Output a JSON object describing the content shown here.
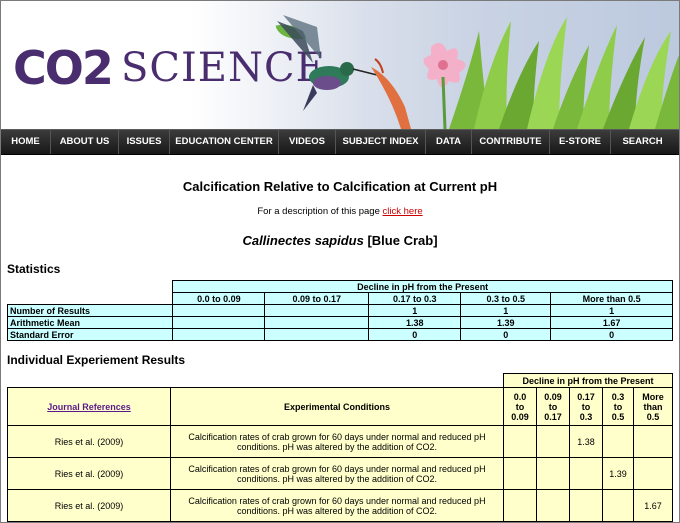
{
  "brand": {
    "co2": "CO2",
    "science": "SCIENCE"
  },
  "nav": [
    "HOME",
    "ABOUT US",
    "ISSUES",
    "EDUCATION CENTER",
    "VIDEOS",
    "SUBJECT INDEX",
    "DATA",
    "CONTRIBUTE",
    "E-STORE",
    "SEARCH"
  ],
  "page": {
    "title": "Calcification Relative to Calcification at Current pH",
    "description": "For a description of this page",
    "link": "click here",
    "species_italic": "Callinectes sapidus",
    "species_common": "[Blue Crab]"
  },
  "statistics": {
    "heading": "Statistics",
    "group_header": "Decline in pH from the Present",
    "columns": [
      "0.0 to 0.09",
      "0.09 to 0.17",
      "0.17 to 0.3",
      "0.3 to 0.5",
      "More than 0.5"
    ],
    "rows": [
      {
        "label": "Number of Results",
        "values": [
          "",
          "",
          "1",
          "1",
          "1"
        ]
      },
      {
        "label": "Arithmetic Mean",
        "values": [
          "",
          "",
          "1.38",
          "1.39",
          "1.67"
        ]
      },
      {
        "label": "Standard Error",
        "values": [
          "",
          "",
          "0",
          "0",
          "0"
        ]
      }
    ]
  },
  "experiments": {
    "heading": "Individual Experiement Results",
    "group_header": "Decline in pH from the Present",
    "col_journal": "Journal References",
    "col_conditions": "Experimental Conditions",
    "columns": [
      [
        "0.0",
        "to",
        "0.09"
      ],
      [
        "0.09",
        "to",
        "0.17"
      ],
      [
        "0.17",
        "to",
        "0.3"
      ],
      [
        "0.3",
        "to",
        "0.5"
      ],
      [
        "More",
        "than",
        "0.5"
      ]
    ],
    "rows": [
      {
        "ref": "Ries et al. (2009)",
        "cond": "Calcification rates of crab grown for 60 days under normal and reduced pH conditions. pH was altered by the addition of CO2.",
        "values": [
          "",
          "",
          "1.38",
          "",
          ""
        ]
      },
      {
        "ref": "Ries et al. (2009)",
        "cond": "Calcification rates of crab grown for 60 days under normal and reduced pH conditions. pH was altered by the addition of CO2.",
        "values": [
          "",
          "",
          "",
          "1.39",
          ""
        ]
      },
      {
        "ref": "Ries et al. (2009)",
        "cond": "Calcification rates of crab grown for 60 days under normal and reduced pH conditions. pH was altered by the addition of CO2.",
        "values": [
          "",
          "",
          "",
          "",
          "1.67"
        ]
      }
    ]
  }
}
